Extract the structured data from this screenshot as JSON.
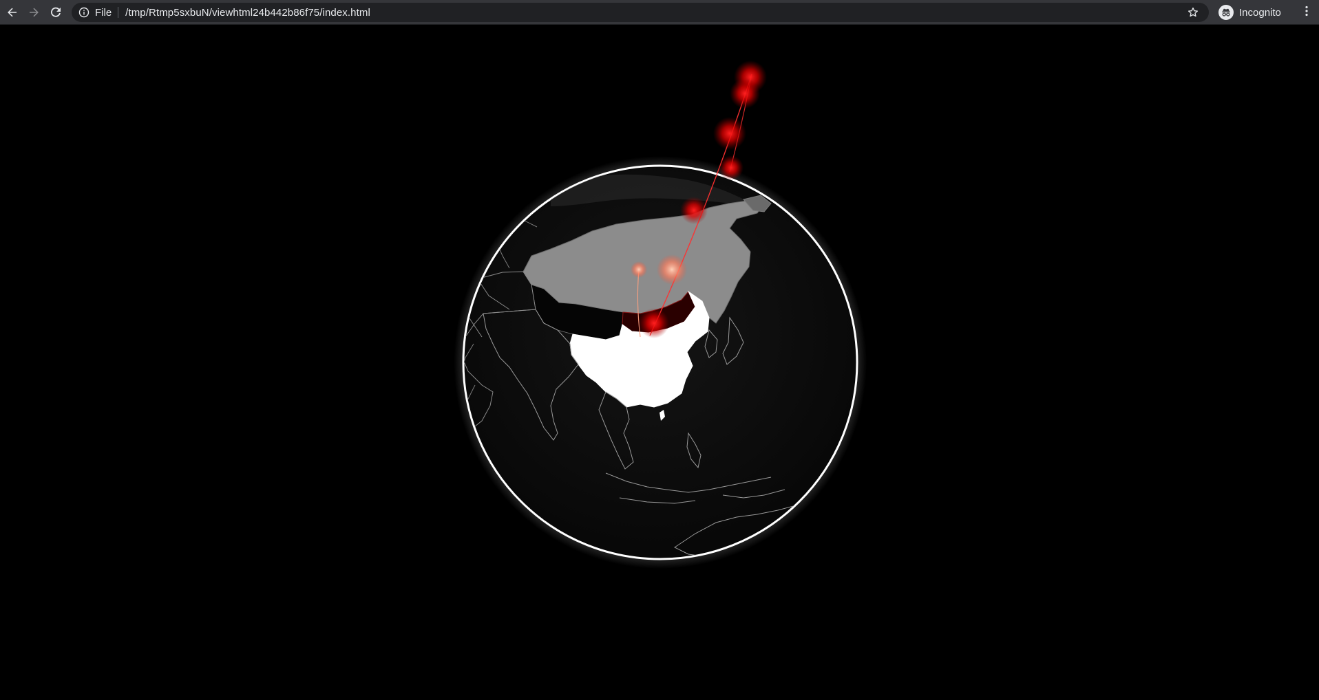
{
  "browser": {
    "scheme_label": "File",
    "url": "/tmp/Rtmp5sxbuN/viewhtml24b442b86f75/index.html",
    "profile_label": "Incognito",
    "icons": {
      "back": "arrow-left-icon",
      "forward": "arrow-right-icon",
      "reload": "reload-icon",
      "info": "info-icon",
      "bookmark": "star-icon",
      "incognito": "incognito-icon",
      "menu": "kebab-menu-icon"
    }
  },
  "scene": {
    "background": "#000000",
    "globe_fill": "#0b0b0b",
    "atmosphere_glow": "#ffffff",
    "border_lines": "#9a9a9a",
    "highlighted_country_color": "#ffffff",
    "neighbor_country_color": "#8c8c8c",
    "arc_color": "#ff1a1a",
    "secondary_arc_color": "#ffb08a"
  }
}
